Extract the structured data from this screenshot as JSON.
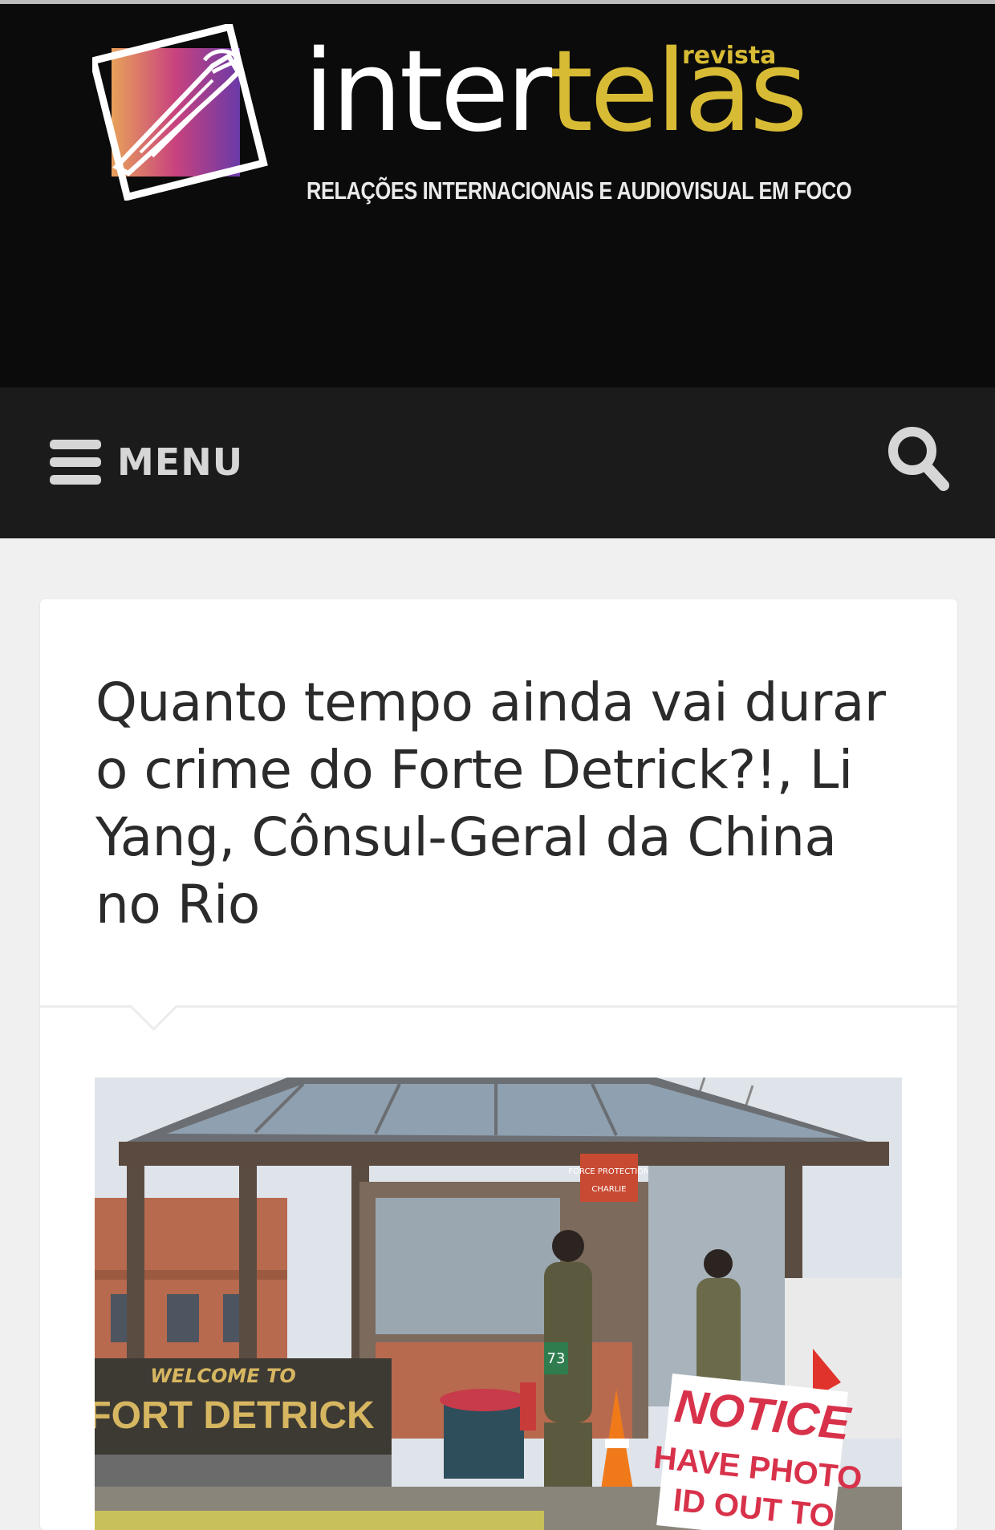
{
  "site": {
    "logo_main_1": "inter",
    "logo_main_2": "telas",
    "logo_revista": "revista",
    "tagline": "RELAÇÕES INTERNACIONAIS E AUDIOVISUAL EM FOCO"
  },
  "nav": {
    "menu_label": "MENU",
    "menu_icon": "hamburger-icon",
    "search_icon": "search-icon"
  },
  "article": {
    "title": "Quanto tempo ainda vai durar o crime do Forte Detrick?!, Li Yang, Cônsul-Geral da China no Rio",
    "image": {
      "sign_top": "WELCOME TO",
      "sign_main": "FORT DETRICK",
      "notice_title": "NOTICE",
      "notice_line1": "HAVE PHOTO",
      "notice_line2": "ID OUT TO",
      "booth_sign": "FORCE PROTECTION",
      "booth_sign2": "CHARLIE",
      "route": "73"
    }
  },
  "colors": {
    "header_bg": "#0b0b0b",
    "nav_bg": "#1b1b1b",
    "accent_gold": "#d8bb35",
    "page_bg": "#f0f0f0"
  }
}
